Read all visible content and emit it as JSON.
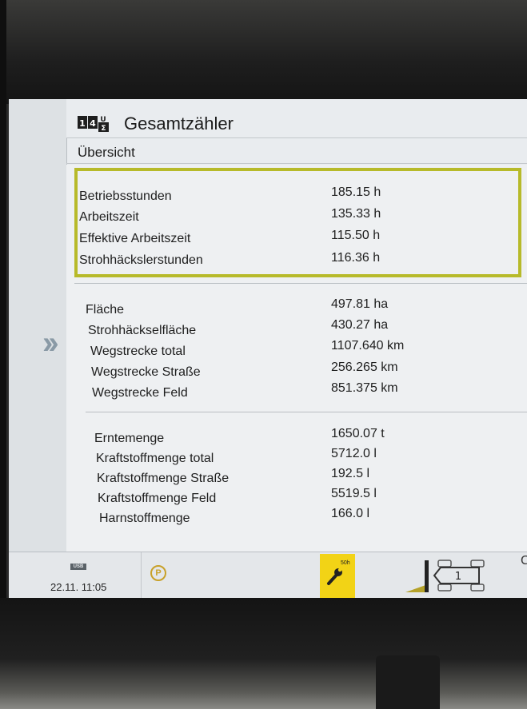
{
  "header": {
    "icon": "total-counter-icon",
    "title": "Gesamtzähler",
    "subtitle": "Übersicht"
  },
  "groups": [
    {
      "rows": [
        {
          "label": "Betriebsstunden",
          "value": "185.15 h"
        },
        {
          "label": "Arbeitszeit",
          "value": "135.33 h"
        },
        {
          "label": "Effektive Arbeitszeit",
          "value": "115.50 h"
        },
        {
          "label": "Strohhäckslerstunden",
          "value": "116.36 h"
        }
      ]
    },
    {
      "rows": [
        {
          "label": "Fläche",
          "value": "497.81 ha"
        },
        {
          "label": "Strohhäckselfläche",
          "value": "430.27 ha"
        },
        {
          "label": "Wegstrecke total",
          "value": "1107.640 km"
        },
        {
          "label": "Wegstrecke Straße",
          "value": "256.265 km"
        },
        {
          "label": "Wegstrecke Feld",
          "value": "851.375 km"
        }
      ]
    },
    {
      "rows": [
        {
          "label": "Erntemenge",
          "value": "1650.07 t"
        },
        {
          "label": "Kraftstoffmenge total",
          "value": "5712.0 l"
        },
        {
          "label": "Kraftstoffmenge Straße",
          "value": "192.5 l"
        },
        {
          "label": "Kraftstoffmenge Feld",
          "value": "5519.5 l"
        },
        {
          "label": "Harnstoffmenge",
          "value": "166.0 l"
        }
      ]
    }
  ],
  "status": {
    "usb_label": "USB",
    "datetime": "22.11.  11:05",
    "parking_label": "P",
    "service_label": "50h",
    "machine_gear": "1",
    "edge_glyph": "C"
  },
  "colors": {
    "highlight_border": "#b7ba2a",
    "service_bg": "#f2d316",
    "screen_bg": "#e9ecef"
  }
}
